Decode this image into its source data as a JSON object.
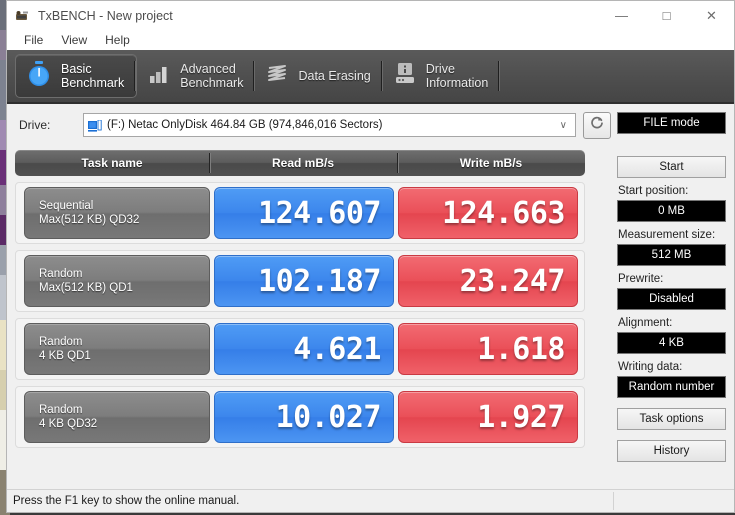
{
  "window": {
    "title": "TxBENCH - New project",
    "app_icon": "txbench-icon",
    "minimize": "—",
    "maximize": "□",
    "close": "✕"
  },
  "menubar": {
    "items": [
      {
        "label": "File"
      },
      {
        "label": "View"
      },
      {
        "label": "Help"
      }
    ]
  },
  "tabs": [
    {
      "label": "Basic\nBenchmark",
      "icon": "stopwatch-icon",
      "active": true
    },
    {
      "label": "Advanced\nBenchmark",
      "icon": "bar-chart-icon",
      "active": false
    },
    {
      "label": "Data Erasing",
      "icon": "eraser-icon",
      "active": false
    },
    {
      "label": "Drive\nInformation",
      "icon": "drive-info-icon",
      "active": false
    }
  ],
  "drive": {
    "label": "Drive:",
    "value": "(F:) Netac OnlyDisk  464.84 GB (974,846,016 Sectors)",
    "icon": "hard-drive-icon",
    "caret": "∨",
    "refresh_icon": "refresh-icon"
  },
  "table": {
    "headers": [
      "Task name",
      "Read mB/s",
      "Write mB/s"
    ],
    "rows": [
      {
        "task_line1": "Sequential",
        "task_line2": "Max(512 KB) QD32",
        "read": "124.607",
        "write": "124.663"
      },
      {
        "task_line1": "Random",
        "task_line2": "Max(512 KB) QD1",
        "read": "102.187",
        "write": "23.247"
      },
      {
        "task_line1": "Random",
        "task_line2": "4 KB QD1",
        "read": "4.621",
        "write": "1.618"
      },
      {
        "task_line1": "Random",
        "task_line2": "4 KB QD32",
        "read": "10.027",
        "write": "1.927"
      }
    ]
  },
  "panel": {
    "mode": "FILE mode",
    "start_button": "Start",
    "start_position_label": "Start position:",
    "start_position_value": "0 MB",
    "measurement_size_label": "Measurement size:",
    "measurement_size_value": "512 MB",
    "prewrite_label": "Prewrite:",
    "prewrite_value": "Disabled",
    "alignment_label": "Alignment:",
    "alignment_value": "4 KB",
    "writing_data_label": "Writing data:",
    "writing_data_value": "Random number",
    "task_options_button": "Task options",
    "history_button": "History"
  },
  "statusbar": {
    "text": "Press the F1 key to show the online manual."
  },
  "colors": {
    "read_blue": "#3c86ec",
    "write_red": "#ea4f58",
    "tabstrip_dark": "#4f4f4f",
    "task_grey": "#7d7d7d",
    "mode_box_black": "#000000"
  }
}
